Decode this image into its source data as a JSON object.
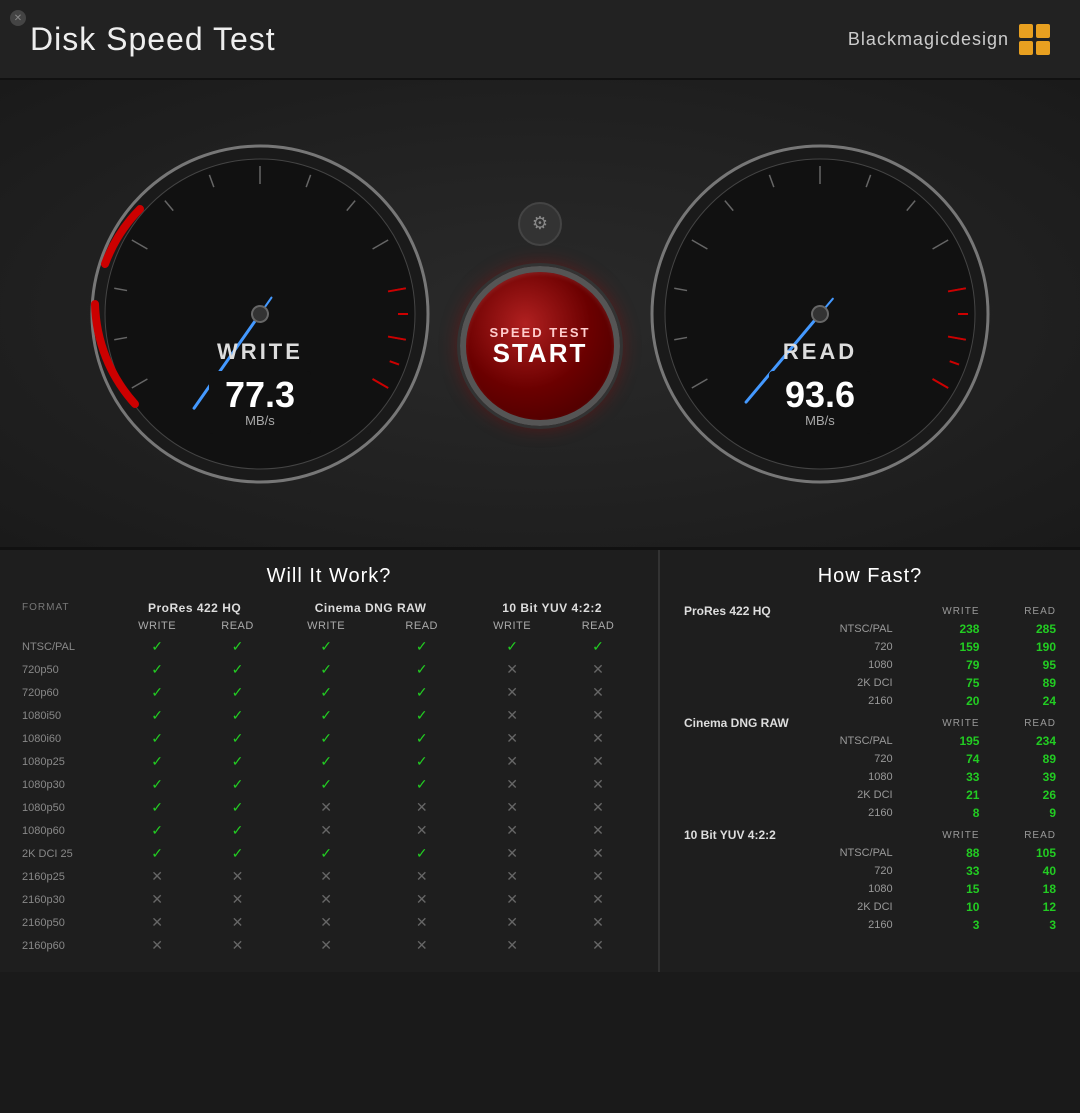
{
  "titleBar": {
    "title": "Disk Speed Test",
    "brand": "Blackmagicdesign"
  },
  "gauges": {
    "write": {
      "label": "WRITE",
      "value": "77.3",
      "unit": "MB/s",
      "needle_angle": -35
    },
    "read": {
      "label": "READ",
      "value": "93.6",
      "unit": "MB/s",
      "needle_angle": -20
    }
  },
  "startButton": {
    "line1": "SPEED TEST",
    "line2": "START"
  },
  "willItWork": {
    "title": "Will It Work?",
    "columns": [
      {
        "group": "ProRes 422 HQ",
        "cols": [
          "WRITE",
          "READ"
        ]
      },
      {
        "group": "Cinema DNG RAW",
        "cols": [
          "WRITE",
          "READ"
        ]
      },
      {
        "group": "10 Bit YUV 4:2:2",
        "cols": [
          "WRITE",
          "READ"
        ]
      }
    ],
    "formatHeader": "FORMAT",
    "rows": [
      {
        "format": "NTSC/PAL",
        "data": [
          1,
          1,
          1,
          1,
          1,
          1
        ]
      },
      {
        "format": "720p50",
        "data": [
          1,
          1,
          1,
          1,
          0,
          0
        ]
      },
      {
        "format": "720p60",
        "data": [
          1,
          1,
          1,
          1,
          0,
          0
        ]
      },
      {
        "format": "1080i50",
        "data": [
          1,
          1,
          1,
          1,
          0,
          0
        ]
      },
      {
        "format": "1080i60",
        "data": [
          1,
          1,
          1,
          1,
          0,
          0
        ]
      },
      {
        "format": "1080p25",
        "data": [
          1,
          1,
          1,
          1,
          0,
          0
        ]
      },
      {
        "format": "1080p30",
        "data": [
          1,
          1,
          1,
          1,
          0,
          0
        ]
      },
      {
        "format": "1080p50",
        "data": [
          1,
          1,
          0,
          0,
          0,
          0
        ]
      },
      {
        "format": "1080p60",
        "data": [
          1,
          1,
          0,
          0,
          0,
          0
        ]
      },
      {
        "format": "2K DCI 25",
        "data": [
          1,
          1,
          1,
          1,
          0,
          0
        ]
      },
      {
        "format": "2160p25",
        "data": [
          0,
          0,
          0,
          0,
          0,
          0
        ]
      },
      {
        "format": "2160p30",
        "data": [
          0,
          0,
          0,
          0,
          0,
          0
        ]
      },
      {
        "format": "2160p50",
        "data": [
          0,
          0,
          0,
          0,
          0,
          0
        ]
      },
      {
        "format": "2160p60",
        "data": [
          0,
          0,
          0,
          0,
          0,
          0
        ]
      }
    ]
  },
  "howFast": {
    "title": "How Fast?",
    "groups": [
      {
        "name": "ProRes 422 HQ",
        "rows": [
          {
            "label": "NTSC/PAL",
            "write": 238,
            "read": 285
          },
          {
            "label": "720",
            "write": 159,
            "read": 190
          },
          {
            "label": "1080",
            "write": 79,
            "read": 95
          },
          {
            "label": "2K DCI",
            "write": 75,
            "read": 89
          },
          {
            "label": "2160",
            "write": 20,
            "read": 24
          }
        ]
      },
      {
        "name": "Cinema DNG RAW",
        "rows": [
          {
            "label": "NTSC/PAL",
            "write": 195,
            "read": 234
          },
          {
            "label": "720",
            "write": 74,
            "read": 89
          },
          {
            "label": "1080",
            "write": 33,
            "read": 39
          },
          {
            "label": "2K DCI",
            "write": 21,
            "read": 26
          },
          {
            "label": "2160",
            "write": 8,
            "read": 9
          }
        ]
      },
      {
        "name": "10 Bit YUV 4:2:2",
        "rows": [
          {
            "label": "NTSC/PAL",
            "write": 88,
            "read": 105
          },
          {
            "label": "720",
            "write": 33,
            "read": 40
          },
          {
            "label": "1080",
            "write": 15,
            "read": 18
          },
          {
            "label": "2K DCI",
            "write": 10,
            "read": 12
          },
          {
            "label": "2160",
            "write": 3,
            "read": 3
          }
        ]
      }
    ]
  }
}
